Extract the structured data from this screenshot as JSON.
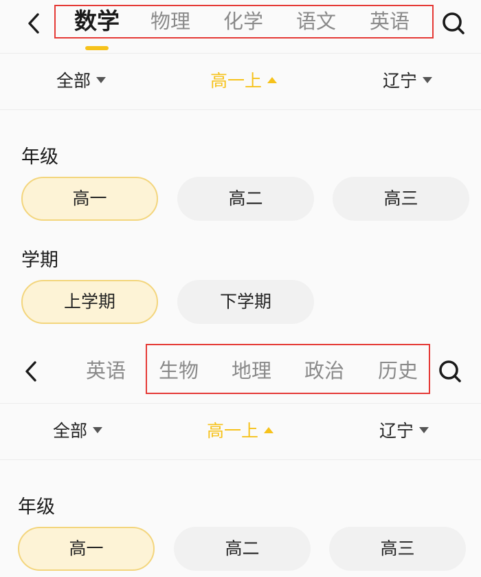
{
  "screen1": {
    "tabs": [
      {
        "label": "数学",
        "active": true
      },
      {
        "label": "物理",
        "active": false
      },
      {
        "label": "化学",
        "active": false
      },
      {
        "label": "语文",
        "active": false
      },
      {
        "label": "英语",
        "active": false
      }
    ],
    "filters": {
      "scope": "全部",
      "grade_term": "高一上",
      "region": "辽宁"
    },
    "grade_section": {
      "title": "年级",
      "options": [
        {
          "label": "高一",
          "selected": true
        },
        {
          "label": "高二",
          "selected": false
        },
        {
          "label": "高三",
          "selected": false
        }
      ]
    },
    "term_section": {
      "title": "学期",
      "options": [
        {
          "label": "上学期",
          "selected": true
        },
        {
          "label": "下学期",
          "selected": false
        }
      ]
    }
  },
  "screen2": {
    "tabs": [
      {
        "label": "英语",
        "active": false
      },
      {
        "label": "生物",
        "active": false
      },
      {
        "label": "地理",
        "active": false
      },
      {
        "label": "政治",
        "active": false
      },
      {
        "label": "历史",
        "active": false
      }
    ],
    "filters": {
      "scope": "全部",
      "grade_term": "高一上",
      "region": "辽宁"
    },
    "grade_section": {
      "title": "年级",
      "options": [
        {
          "label": "高一",
          "selected": true
        },
        {
          "label": "高二",
          "selected": false
        },
        {
          "label": "高三",
          "selected": false
        }
      ]
    }
  },
  "icons": {
    "back": "chevron-left-icon",
    "search": "search-icon",
    "dropdown": "caret-down-icon",
    "dropdown_open": "caret-up-icon"
  },
  "colors": {
    "accent": "#f6c21b",
    "highlight_box": "#e53935",
    "pill_selected_bg": "#fdf3d6",
    "pill_bg": "#f1f1f1"
  }
}
